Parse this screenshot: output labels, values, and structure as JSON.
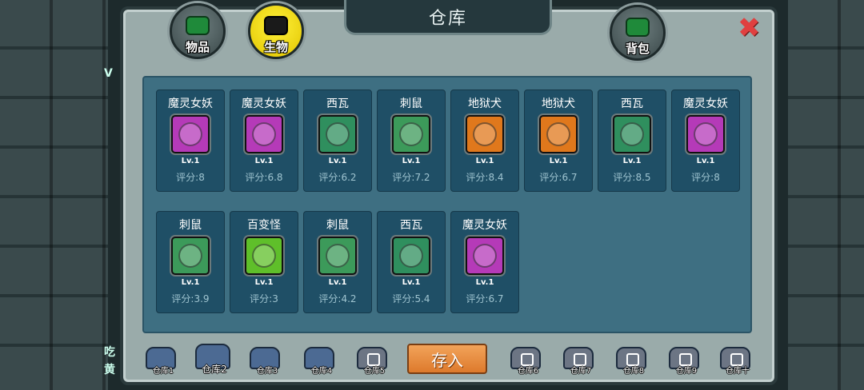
{
  "title": "仓库",
  "tabs": {
    "items_label": "物品",
    "creatures_label": "生物",
    "bag_label": "背包"
  },
  "close_symbol": "✖",
  "side_text": {
    "top": "V",
    "bottom_1": "吃",
    "bottom_2": "黄"
  },
  "cards": [
    {
      "name": "魔灵女妖",
      "level": "Lv.1",
      "score": "评分:8",
      "color": "#b53ab8"
    },
    {
      "name": "魔灵女妖",
      "level": "Lv.1",
      "score": "评分:6.8",
      "color": "#b53ab8"
    },
    {
      "name": "西瓦",
      "level": "Lv.1",
      "score": "评分:6.2",
      "color": "#2f8f5e"
    },
    {
      "name": "刺鼠",
      "level": "Lv.1",
      "score": "评分:7.2",
      "color": "#3c9a5a"
    },
    {
      "name": "地狱犬",
      "level": "Lv.1",
      "score": "评分:8.4",
      "color": "#e0781c"
    },
    {
      "name": "地狱犬",
      "level": "Lv.1",
      "score": "评分:6.7",
      "color": "#e0781c"
    },
    {
      "name": "西瓦",
      "level": "Lv.1",
      "score": "评分:8.5",
      "color": "#2f8f5e"
    },
    {
      "name": "魔灵女妖",
      "level": "Lv.1",
      "score": "评分:8",
      "color": "#b53ab8"
    },
    {
      "name": "刺鼠",
      "level": "Lv.1",
      "score": "评分:3.9",
      "color": "#3c9a5a"
    },
    {
      "name": "百变怪",
      "level": "Lv.1",
      "score": "评分:3",
      "color": "#5fbf2a"
    },
    {
      "name": "刺鼠",
      "level": "Lv.1",
      "score": "评分:4.2",
      "color": "#3c9a5a"
    },
    {
      "name": "西瓦",
      "level": "Lv.1",
      "score": "评分:5.4",
      "color": "#2f8f5e"
    },
    {
      "name": "魔灵女妖",
      "level": "Lv.1",
      "score": "评分:6.7",
      "color": "#b53ab8"
    }
  ],
  "store_button": "存入",
  "warehouses": [
    {
      "label": "仓库1",
      "state": "open"
    },
    {
      "label": "仓库2",
      "state": "active"
    },
    {
      "label": "仓库3",
      "state": "open"
    },
    {
      "label": "仓库4",
      "state": "open"
    },
    {
      "label": "仓库5",
      "state": "locked"
    },
    {
      "label": "仓库6",
      "state": "locked"
    },
    {
      "label": "仓库7",
      "state": "locked"
    },
    {
      "label": "仓库8",
      "state": "locked"
    },
    {
      "label": "仓库9",
      "state": "locked"
    },
    {
      "label": "仓库十",
      "state": "locked"
    }
  ]
}
